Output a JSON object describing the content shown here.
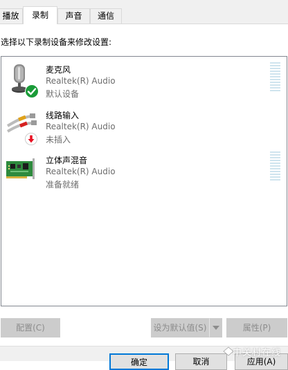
{
  "tabs": [
    {
      "label": "播放",
      "selected": false,
      "visible_text": "播放"
    },
    {
      "label": "录制",
      "selected": true
    },
    {
      "label": "声音",
      "selected": false
    },
    {
      "label": "通信",
      "selected": false
    }
  ],
  "instruction": "选择以下录制设备来修改设置:",
  "devices": [
    {
      "name": "麦克风",
      "driver": "Realtek(R) Audio",
      "status": "默认设备",
      "icon": "microphone-icon",
      "badge": "default-check-badge",
      "badge_color": "#1a9b38",
      "has_meter": true
    },
    {
      "name": "线路输入",
      "driver": "Realtek(R) Audio",
      "status": "未插入",
      "icon": "line-in-cable-icon",
      "badge": "unplugged-arrow-badge",
      "badge_color": "#e81123",
      "has_meter": false
    },
    {
      "name": "立体声混音",
      "driver": "Realtek(R) Audio",
      "status": "准备就绪",
      "icon": "sound-card-icon",
      "has_meter": true
    }
  ],
  "buttons": {
    "configure": "配置(C)",
    "set_default": "设为默认值(S)",
    "properties": "属性(P)",
    "ok": "确定",
    "cancel": "取消",
    "apply": "应用(A)"
  },
  "watermark": "中关村在线",
  "colors": {
    "selection_accent": "#0078d7",
    "disabled_button_bg": "#cccccc",
    "meter_bar": "#cfe4ee"
  }
}
